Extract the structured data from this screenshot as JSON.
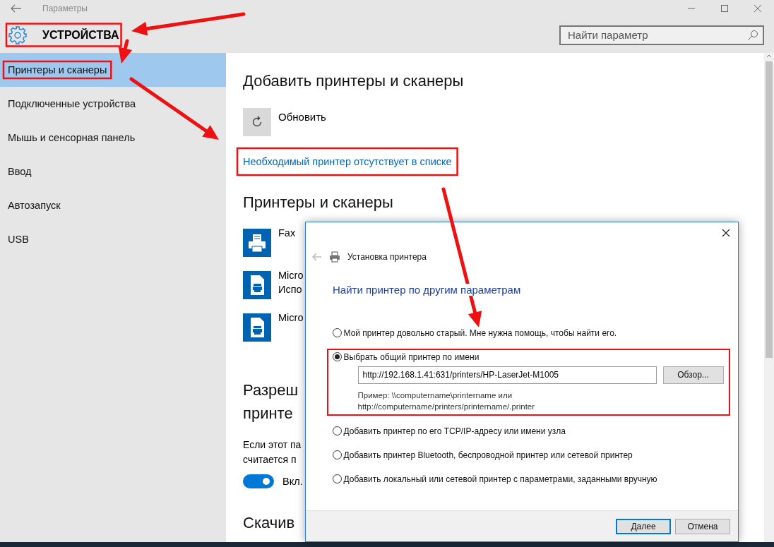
{
  "window": {
    "title": "Параметры"
  },
  "header": {
    "title": "УСТРОЙСТВА",
    "highlighted": true
  },
  "search": {
    "placeholder": "Найти параметр"
  },
  "sidebar": {
    "items": [
      {
        "label": "Принтеры и сканеры",
        "selected": true,
        "highlighted": true
      },
      {
        "label": "Подключенные устройства",
        "selected": false,
        "highlighted": false
      },
      {
        "label": "Мышь и сенсорная панель",
        "selected": false,
        "highlighted": false
      },
      {
        "label": "Ввод",
        "selected": false,
        "highlighted": false
      },
      {
        "label": "Автозапуск",
        "selected": false,
        "highlighted": false
      },
      {
        "label": "USB",
        "selected": false,
        "highlighted": false
      }
    ]
  },
  "content": {
    "add_heading": "Добавить принтеры и сканеры",
    "refresh_button": {
      "label": "Обновить"
    },
    "missing_link": {
      "text": "Необходимый принтер отсутствует в списке",
      "highlighted": true
    },
    "printers_heading": "Принтеры и сканеры",
    "printers": [
      {
        "kind": "printer",
        "name_lines": [
          "Fax"
        ]
      },
      {
        "kind": "document",
        "name_lines": [
          "Micro",
          "Испо"
        ]
      },
      {
        "kind": "document",
        "name_lines": [
          "Micro"
        ]
      }
    ],
    "allow_heading_lines": [
      "Разреш",
      "принте"
    ],
    "allow_text_lines": [
      "Если этот па",
      "считается п"
    ],
    "toggle": {
      "on": true,
      "label": "Вкл."
    },
    "download_heading": "Скачив"
  },
  "dialog": {
    "title": "Установка принтера",
    "heading": "Найти принтер по другим параметрам",
    "options": [
      {
        "label": "Мой принтер довольно старый. Мне нужна помощь, чтобы найти его.",
        "selected": false,
        "highlighted": false
      },
      {
        "label": "Выбрать общий принтер по имени",
        "selected": true,
        "highlighted": true,
        "address": {
          "value": "http://192.168.1.41:631/printers/HP-LaserJet-M1005"
        },
        "browse_button": "Обзор...",
        "hint_lines": [
          "Пример: \\\\computername\\printername или",
          "http://computername/printers/printername/.printer"
        ]
      },
      {
        "label": "Добавить принтер по его TCP/IP-адресу или имени узла",
        "selected": false,
        "highlighted": false
      },
      {
        "label": "Добавить принтер Bluetooth, беспроводной принтер или сетевой принтер",
        "selected": false,
        "highlighted": false
      },
      {
        "label": "Добавить локальный или сетевой принтер с параметрами, заданными вручную",
        "selected": false,
        "highlighted": false
      }
    ],
    "buttons": [
      {
        "label": "Далее",
        "default": true
      },
      {
        "label": "Отмена",
        "default": false
      }
    ]
  }
}
